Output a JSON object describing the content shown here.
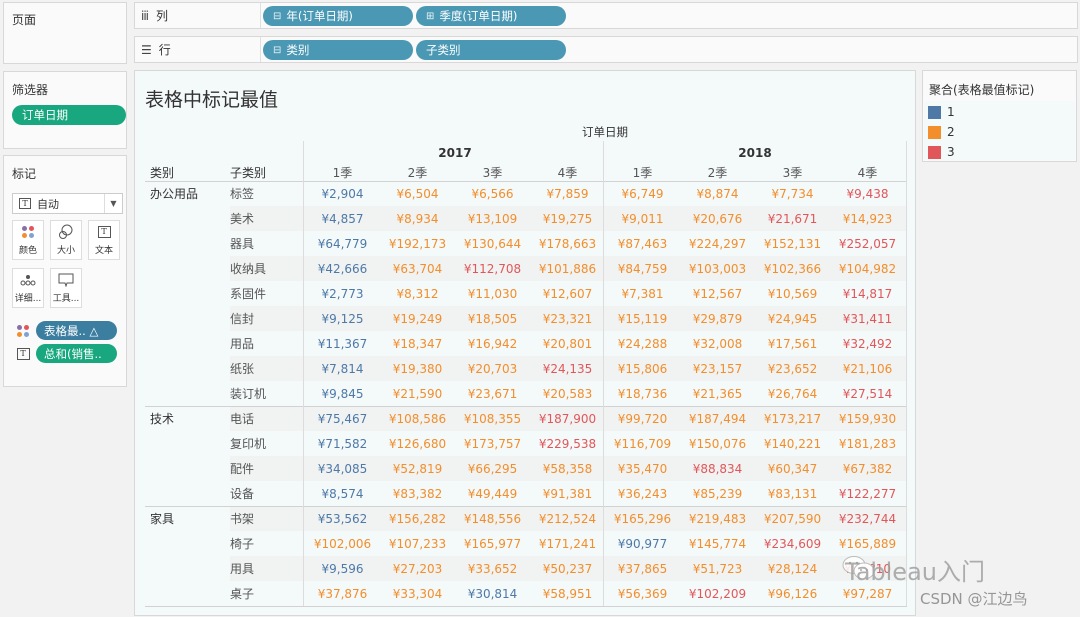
{
  "pages": {
    "title": "页面"
  },
  "columns_shelf": {
    "label": "列",
    "icon": "columns-icon",
    "pills": [
      {
        "label": "年(订单日期)",
        "prefix": "⊟"
      },
      {
        "label": "季度(订单日期)",
        "prefix": "⊞"
      }
    ]
  },
  "rows_shelf": {
    "label": "行",
    "icon": "rows-icon",
    "pills": [
      {
        "label": "类别",
        "prefix": "⊟"
      },
      {
        "label": "子类别",
        "prefix": ""
      }
    ]
  },
  "filters": {
    "title": "筛选器",
    "items": [
      "订单日期"
    ]
  },
  "marks": {
    "title": "标记",
    "mark_type": "自动",
    "buttons": {
      "color": "颜色",
      "size": "大小",
      "text": "文本",
      "detail": "详细...",
      "tooltip": "工具..."
    },
    "fields": [
      {
        "label": "表格最.. △",
        "type": "color",
        "color": "#3c7ea0"
      },
      {
        "label": "总和(销售..",
        "type": "text",
        "color": "#18a77e"
      }
    ]
  },
  "view": {
    "title": "表格中标记最值",
    "column_field_title": "订单日期",
    "row_headers": [
      "类别",
      "子类别"
    ],
    "years": [
      "2017",
      "2018"
    ],
    "quarters": [
      "1季",
      "2季",
      "3季",
      "4季"
    ],
    "groups": [
      {
        "category": "办公用品",
        "rows": [
          {
            "sub": "标签",
            "values": [
              "¥2,904",
              "¥6,504",
              "¥6,566",
              "¥7,859",
              "¥6,749",
              "¥8,874",
              "¥7,734",
              "¥9,438"
            ],
            "marks": [
              1,
              2,
              2,
              2,
              2,
              2,
              2,
              3
            ]
          },
          {
            "sub": "美术",
            "values": [
              "¥4,857",
              "¥8,934",
              "¥13,109",
              "¥19,275",
              "¥9,011",
              "¥20,676",
              "¥21,671",
              "¥14,923"
            ],
            "marks": [
              1,
              2,
              2,
              2,
              2,
              2,
              3,
              2
            ]
          },
          {
            "sub": "器具",
            "values": [
              "¥64,779",
              "¥192,173",
              "¥130,644",
              "¥178,663",
              "¥87,463",
              "¥224,297",
              "¥152,131",
              "¥252,057"
            ],
            "marks": [
              1,
              2,
              2,
              2,
              2,
              2,
              2,
              3
            ]
          },
          {
            "sub": "收纳具",
            "values": [
              "¥42,666",
              "¥63,704",
              "¥112,708",
              "¥101,886",
              "¥84,759",
              "¥103,003",
              "¥102,366",
              "¥104,982"
            ],
            "marks": [
              1,
              2,
              3,
              2,
              2,
              2,
              2,
              2
            ]
          },
          {
            "sub": "系固件",
            "values": [
              "¥2,773",
              "¥8,312",
              "¥11,030",
              "¥12,607",
              "¥7,381",
              "¥12,567",
              "¥10,569",
              "¥14,817"
            ],
            "marks": [
              1,
              2,
              2,
              2,
              2,
              2,
              2,
              3
            ]
          },
          {
            "sub": "信封",
            "values": [
              "¥9,125",
              "¥19,249",
              "¥18,505",
              "¥23,321",
              "¥15,119",
              "¥29,879",
              "¥24,945",
              "¥31,411"
            ],
            "marks": [
              1,
              2,
              2,
              2,
              2,
              2,
              2,
              3
            ]
          },
          {
            "sub": "用品",
            "values": [
              "¥11,367",
              "¥18,347",
              "¥16,942",
              "¥20,801",
              "¥24,288",
              "¥32,008",
              "¥17,561",
              "¥32,492"
            ],
            "marks": [
              1,
              2,
              2,
              2,
              2,
              2,
              2,
              3
            ]
          },
          {
            "sub": "纸张",
            "values": [
              "¥7,814",
              "¥19,380",
              "¥20,703",
              "¥24,135",
              "¥15,806",
              "¥23,157",
              "¥23,652",
              "¥21,106"
            ],
            "marks": [
              1,
              2,
              2,
              3,
              2,
              2,
              2,
              2
            ]
          },
          {
            "sub": "装订机",
            "values": [
              "¥9,845",
              "¥21,590",
              "¥23,671",
              "¥20,583",
              "¥18,736",
              "¥21,365",
              "¥26,764",
              "¥27,514"
            ],
            "marks": [
              1,
              2,
              2,
              2,
              2,
              2,
              2,
              3
            ]
          }
        ]
      },
      {
        "category": "技术",
        "rows": [
          {
            "sub": "电话",
            "values": [
              "¥75,467",
              "¥108,586",
              "¥108,355",
              "¥187,900",
              "¥99,720",
              "¥187,494",
              "¥173,217",
              "¥159,930"
            ],
            "marks": [
              1,
              2,
              2,
              3,
              2,
              2,
              2,
              2
            ]
          },
          {
            "sub": "复印机",
            "values": [
              "¥71,582",
              "¥126,680",
              "¥173,757",
              "¥229,538",
              "¥116,709",
              "¥150,076",
              "¥140,221",
              "¥181,283"
            ],
            "marks": [
              1,
              2,
              2,
              3,
              2,
              2,
              2,
              2
            ]
          },
          {
            "sub": "配件",
            "values": [
              "¥34,085",
              "¥52,819",
              "¥66,295",
              "¥58,358",
              "¥35,470",
              "¥88,834",
              "¥60,347",
              "¥67,382"
            ],
            "marks": [
              1,
              2,
              2,
              2,
              2,
              3,
              2,
              2
            ]
          },
          {
            "sub": "设备",
            "values": [
              "¥8,574",
              "¥83,382",
              "¥49,449",
              "¥91,381",
              "¥36,243",
              "¥85,239",
              "¥83,131",
              "¥122,277"
            ],
            "marks": [
              1,
              2,
              2,
              2,
              2,
              2,
              2,
              3
            ]
          }
        ]
      },
      {
        "category": "家具",
        "rows": [
          {
            "sub": "书架",
            "values": [
              "¥53,562",
              "¥156,282",
              "¥148,556",
              "¥212,524",
              "¥165,296",
              "¥219,483",
              "¥207,590",
              "¥232,744"
            ],
            "marks": [
              1,
              2,
              2,
              2,
              2,
              2,
              2,
              3
            ]
          },
          {
            "sub": "椅子",
            "values": [
              "¥102,006",
              "¥107,233",
              "¥165,977",
              "¥171,241",
              "¥90,977",
              "¥145,774",
              "¥234,609",
              "¥165,889"
            ],
            "marks": [
              2,
              2,
              2,
              2,
              1,
              2,
              3,
              2
            ]
          },
          {
            "sub": "用具",
            "values": [
              "¥9,596",
              "¥27,203",
              "¥33,652",
              "¥50,237",
              "¥37,865",
              "¥51,723",
              "¥28,124",
              "¥5?,?10"
            ],
            "marks": [
              1,
              2,
              2,
              2,
              2,
              2,
              2,
              3
            ]
          },
          {
            "sub": "桌子",
            "values": [
              "¥37,876",
              "¥33,304",
              "¥30,814",
              "¥58,951",
              "¥56,369",
              "¥102,209",
              "¥96,126",
              "¥97,287"
            ],
            "marks": [
              2,
              2,
              1,
              2,
              2,
              3,
              2,
              2
            ]
          }
        ]
      }
    ]
  },
  "legend": {
    "title": "聚合(表格最值标记)",
    "items": [
      {
        "label": "1",
        "color": "#4e79a7"
      },
      {
        "label": "2",
        "color": "#f28e2b"
      },
      {
        "label": "3",
        "color": "#e15759"
      }
    ]
  },
  "colors": {
    "pill_blue": "#4a98b4",
    "pill_green": "#18a77e"
  },
  "watermark": {
    "line1": "Tableau入门",
    "line2": "CSDN @江边鸟"
  }
}
